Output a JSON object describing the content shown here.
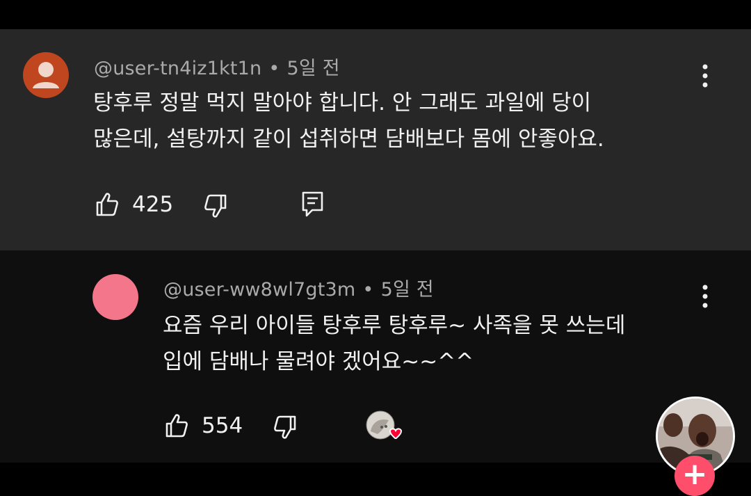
{
  "comments": [
    {
      "username": "@user-tn4iz1kt1n",
      "time": "5일 전",
      "text_lines": [
        "탕후루 정말 먹지 말아야 합니다. 안 그래도 과일에 당이",
        "많은데, 설탕까지 같이 섭취하면 담배보다 몸에 안좋아요."
      ],
      "likes": "425",
      "avatar_color": "#c0461f"
    },
    {
      "username": "@user-ww8wl7gt3m",
      "time": "5일 전",
      "text_lines": [
        "요즘 우리 아이들 탕후루 탕후루~ 사족을 못 쓰는데",
        "입에 담배나 물려야 겠어요~~^^"
      ],
      "likes": "554",
      "avatar_color": "#f4768b"
    }
  ],
  "separator": "•",
  "icons": {
    "like": "thumb-up-icon",
    "dislike": "thumb-down-icon",
    "reply": "comment-reply-icon",
    "more": "more-vertical-icon",
    "creator_heart": "creator-heart-icon",
    "add": "plus-icon"
  },
  "add_button": "+",
  "colors": {
    "comment_bg_highlight": "#272727",
    "comment_bg": "#0f0f0f",
    "secondary_text": "#aaaaaa",
    "heart": "#ff0033",
    "fab": "#ff4e6b"
  }
}
